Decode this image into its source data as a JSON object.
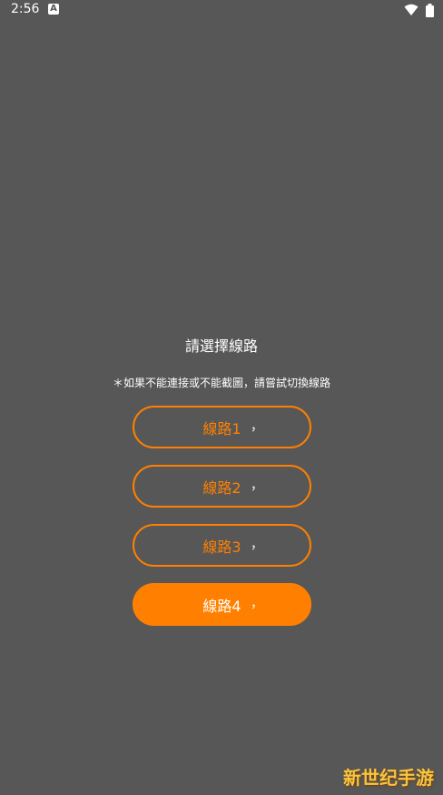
{
  "status_bar": {
    "time": "2:56",
    "app_icon_letter": "A"
  },
  "main": {
    "title": "請選擇線路",
    "hint": "＊如果不能連接或不能截圖，請嘗試切換線路",
    "lines": [
      {
        "label": "線路1",
        "mark": "，",
        "selected": false
      },
      {
        "label": "線路2",
        "mark": "，",
        "selected": false
      },
      {
        "label": "線路3",
        "mark": "，",
        "selected": false
      },
      {
        "label": "線路4",
        "mark": "，",
        "selected": true
      }
    ]
  },
  "watermark": "新世纪手游",
  "colors": {
    "background": "#575757",
    "accent": "#ff8000"
  }
}
